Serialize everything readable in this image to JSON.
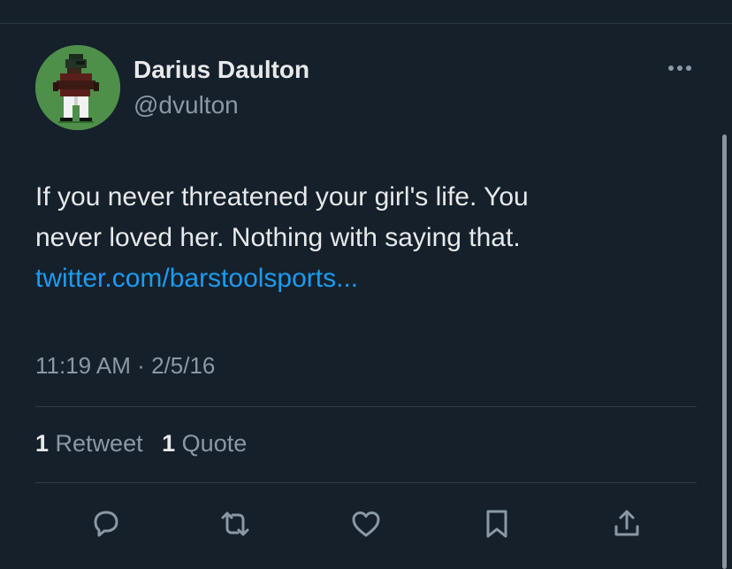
{
  "author": {
    "display_name": "Darius Daulton",
    "handle": "@dvulton",
    "avatar_icon": "pixel-art-player-avatar"
  },
  "tweet": {
    "lines": [
      "If you never threatened your girl's life. You",
      "never loved her. Nothing with saying that."
    ],
    "link": "twitter.com/barstoolsports..."
  },
  "meta": {
    "time": "11:19 AM",
    "separator": "·",
    "date": "2/5/16"
  },
  "stats": {
    "retweets_count": "1",
    "retweets_label": "Retweet",
    "quotes_count": "1",
    "quotes_label": "Quote"
  },
  "actions": [
    "reply-icon",
    "retweet-icon",
    "like-icon",
    "bookmark-icon",
    "share-icon"
  ],
  "colors": {
    "background": "#15202b",
    "text": "#e7e9ea",
    "secondary": "#8b98a5",
    "link": "#1d9bf0",
    "avatar_bg": "#4e8f4a"
  }
}
